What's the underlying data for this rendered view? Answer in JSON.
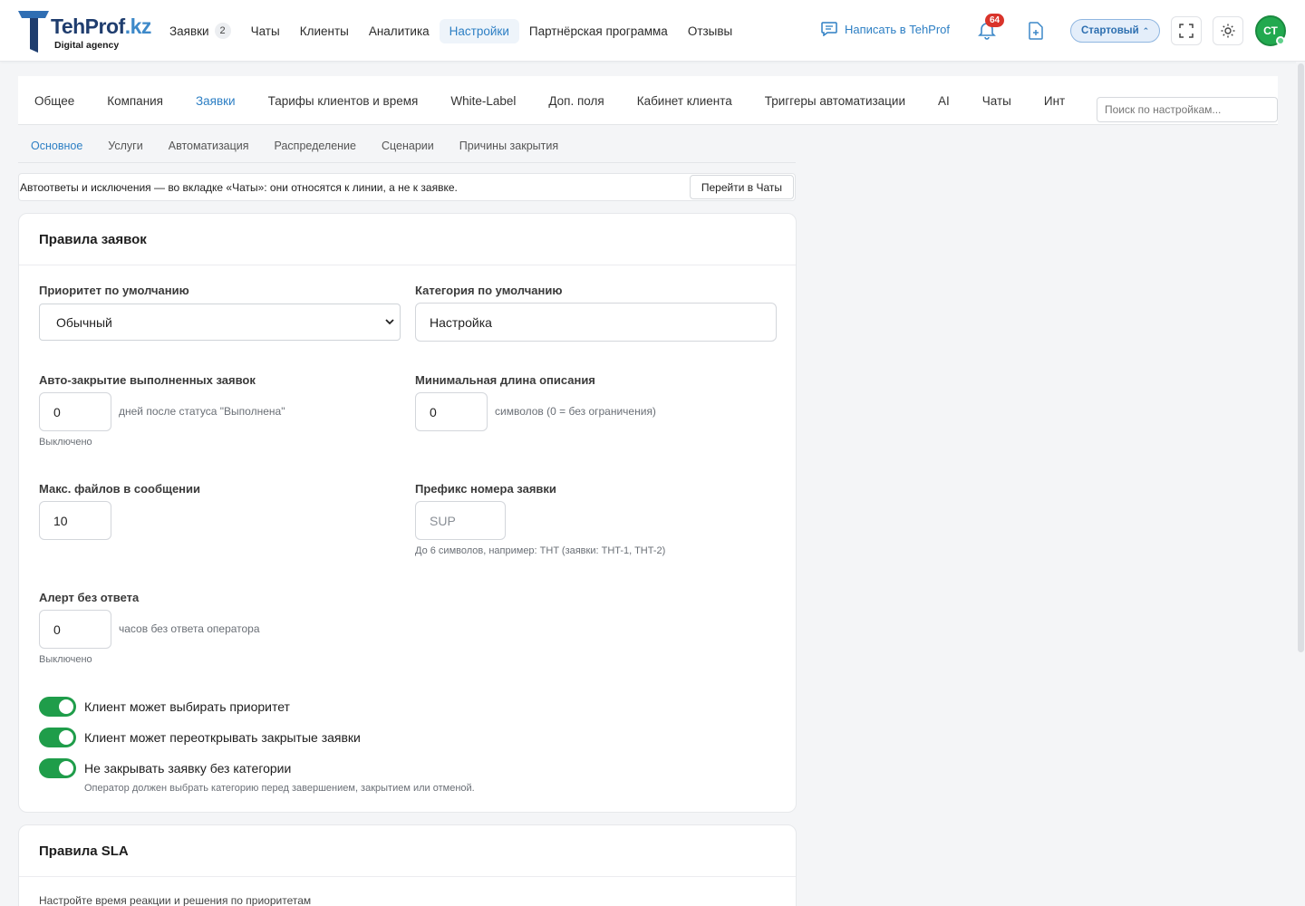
{
  "logo": {
    "word_main": "TehProf",
    "word_tld": ".kz",
    "subtitle": "Digital agency"
  },
  "nav": {
    "items": [
      {
        "label": "Заявки",
        "badge": "2"
      },
      {
        "label": "Чаты"
      },
      {
        "label": "Клиенты"
      },
      {
        "label": "Аналитика"
      },
      {
        "label": "Настройки",
        "active": true
      },
      {
        "label": "Партнёрская программа"
      },
      {
        "label": "Отзывы"
      }
    ]
  },
  "header": {
    "write_link": "Написать в TehProf",
    "notifications_count": "64",
    "plan_label": "Стартовый",
    "avatar_initials": "СТ",
    "icons": [
      "chat-icon",
      "bell-icon",
      "document-add-icon",
      "fullscreen-icon",
      "sun-icon"
    ]
  },
  "settings": {
    "tabs": [
      {
        "label": "Общее"
      },
      {
        "label": "Компания"
      },
      {
        "label": "Заявки",
        "active": true
      },
      {
        "label": "Тарифы клиентов и время"
      },
      {
        "label": "White-Label"
      },
      {
        "label": "Доп. поля"
      },
      {
        "label": "Кабинет клиента"
      },
      {
        "label": "Триггеры автоматизации"
      },
      {
        "label": "AI"
      },
      {
        "label": "Чаты"
      },
      {
        "label": "Инт"
      }
    ],
    "search_placeholder": "Поиск по настройкам...",
    "subtabs": [
      {
        "label": "Основное",
        "active": true
      },
      {
        "label": "Услуги"
      },
      {
        "label": "Автоматизация"
      },
      {
        "label": "Распределение"
      },
      {
        "label": "Сценарии"
      },
      {
        "label": "Причины закрытия"
      }
    ]
  },
  "notice": {
    "text": "Автоответы и исключения — во вкладке «Чаты»: они относятся к линии, а не к заявке.",
    "button": "Перейти в Чаты"
  },
  "rules": {
    "title": "Правила заявок",
    "default_priority": {
      "label": "Приоритет по умолчанию",
      "value": "Обычный"
    },
    "default_category": {
      "label": "Категория по умолчанию",
      "value": "Настройка"
    },
    "auto_close": {
      "label": "Авто-закрытие выполненных заявок",
      "value": "0",
      "suffix": "дней после статуса \"Выполнена\"",
      "note": "Выключено"
    },
    "min_desc": {
      "label": "Минимальная длина описания",
      "value": "0",
      "suffix": "символов (0 = без ограничения)"
    },
    "max_files": {
      "label": "Макс. файлов в сообщении",
      "value": "10"
    },
    "prefix": {
      "label": "Префикс номера заявки",
      "placeholder": "SUP",
      "note": "До 6 символов, например: THT (заявки: THT-1, THT-2)"
    },
    "alert": {
      "label": "Алерт без ответа",
      "value": "0",
      "suffix": "часов без ответа оператора",
      "note": "Выключено"
    },
    "toggles": [
      {
        "label": "Клиент может выбирать приоритет",
        "on": true
      },
      {
        "label": "Клиент может переоткрывать закрытые заявки",
        "on": true
      },
      {
        "label": "Не закрывать заявку без категории",
        "on": true
      }
    ],
    "toggle_note": "Оператор должен выбрать категорию перед завершением, закрытием или отменой."
  },
  "sla": {
    "title": "Правила SLA",
    "description": "Настройте время реакции и решения по приоритетам"
  }
}
